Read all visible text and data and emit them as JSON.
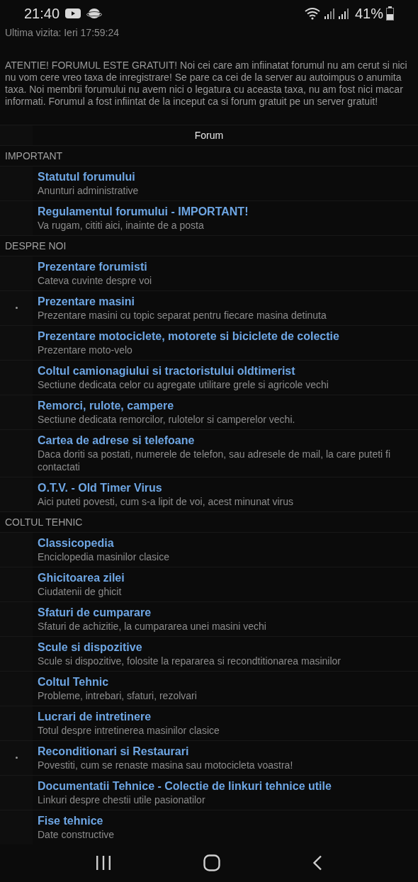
{
  "status_bar": {
    "time": "21:40",
    "battery": "41%"
  },
  "last_visit": "Ultima vizita: Ieri 17:59:24",
  "notice": "ATENTIE! FORUMUL ESTE GRATUIT! Noi cei care am infiinatat forumul nu am cerut si nici nu vom cere vreo taxa de inregistrare! Se pare ca cei de la server au autoimpus o anumita taxa. Noi membrii forumului nu avem nici o legatura cu aceasta taxa, nu am fost nici macar informati. Forumul a fost infiintat de la inceput ca si forum gratuit pe un server gratuit!",
  "table_header": "Forum",
  "categories": [
    {
      "name": "IMPORTANT",
      "forums": [
        {
          "title": "Statutul forumului",
          "description": "Anunturi administrative",
          "new_posts": false
        },
        {
          "title": "Regulamentul forumului - IMPORTANT!",
          "description": "Va rugam, cititi aici, inainte de a posta",
          "new_posts": false
        }
      ]
    },
    {
      "name": "DESPRE NOI",
      "forums": [
        {
          "title": "Prezentare forumisti",
          "description": "Cateva cuvinte despre voi",
          "new_posts": false
        },
        {
          "title": "Prezentare masini",
          "description": "Prezentare masini cu topic separat pentru fiecare masina detinuta",
          "new_posts": true
        },
        {
          "title": "Prezentare motociclete, motorete si biciclete de colectie",
          "description": "Prezentare moto-velo",
          "new_posts": false
        },
        {
          "title": "Coltul camionagiului si tractoristului oldtimerist",
          "description": "Sectiune dedicata celor cu agregate utilitare grele si agricole vechi",
          "new_posts": false
        },
        {
          "title": "Remorci, rulote, campere",
          "description": "Sectiune dedicata remorcilor, rulotelor si camperelor vechi.",
          "new_posts": false
        },
        {
          "title": "Cartea de adrese si telefoane",
          "description": "Daca doriti sa postati, numerele de telefon, sau adresele de mail, la care puteti fi contactati",
          "new_posts": false
        },
        {
          "title": "O.T.V. - Old Timer Virus",
          "description": "Aici puteti povesti, cum s-a lipit de voi, acest minunat virus",
          "new_posts": false
        }
      ]
    },
    {
      "name": "COLTUL TEHNIC",
      "forums": [
        {
          "title": "Classicopedia",
          "description": "Enciclopedia masinilor clasice",
          "new_posts": false
        },
        {
          "title": "Ghicitoarea zilei",
          "description": "Ciudatenii de ghicit",
          "new_posts": false
        },
        {
          "title": "Sfaturi de cumparare",
          "description": "Sfaturi de achizitie, la cumpararea unei masini vechi",
          "new_posts": false
        },
        {
          "title": "Scule si dispozitive",
          "description": "Scule si dispozitive, folosite la repararea si recondtitionarea masinilor",
          "new_posts": false
        },
        {
          "title": "Coltul Tehnic",
          "description": "Probleme, intrebari, sfaturi, rezolvari",
          "new_posts": false
        },
        {
          "title": "Lucrari de intretinere",
          "description": "Totul despre intretinerea masinilor clasice",
          "new_posts": false
        },
        {
          "title": "Reconditionari si Restaurari",
          "description": "Povestiti, cum se renaste masina sau motocicleta voastra!",
          "new_posts": true
        },
        {
          "title": "Documentatii Tehnice - Colectie de linkuri tehnice utile",
          "description": "Linkuri despre chestii utile pasionatilor",
          "new_posts": false
        },
        {
          "title": "Fise tehnice",
          "description": "Date constructive",
          "new_posts": false
        }
      ]
    }
  ]
}
